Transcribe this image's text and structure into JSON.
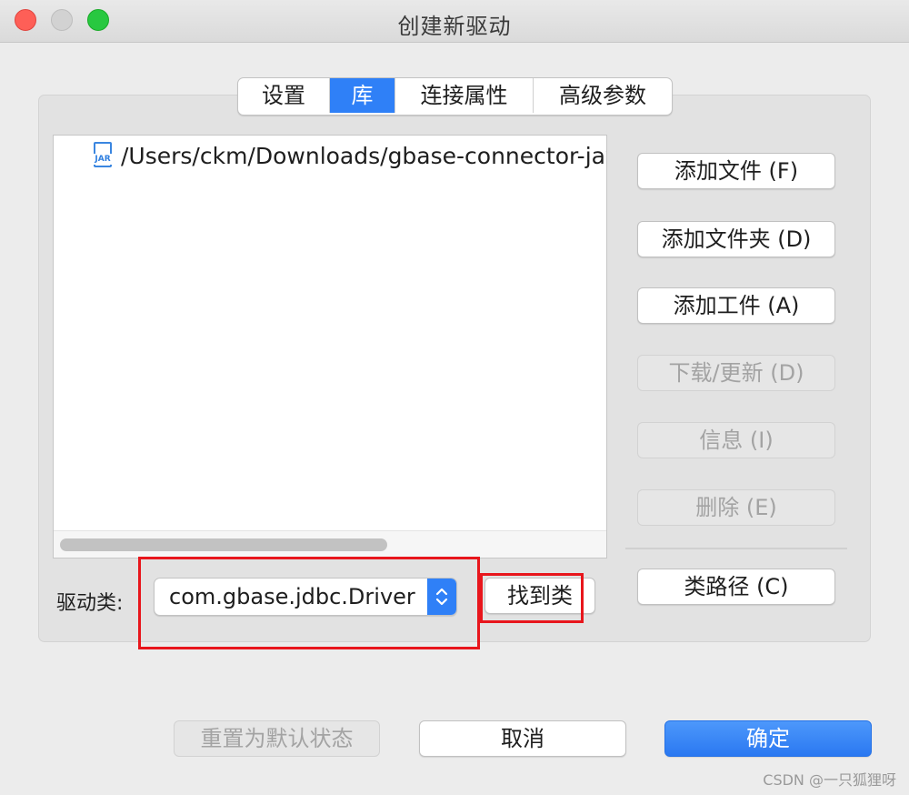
{
  "window": {
    "title": "创建新驱动"
  },
  "tabs": [
    {
      "label": "设置",
      "active": false
    },
    {
      "label": "库",
      "active": true
    },
    {
      "label": "连接属性",
      "active": false
    },
    {
      "label": "高级参数",
      "active": false
    }
  ],
  "library": {
    "items": [
      {
        "icon": "jar-file-icon",
        "icon_text": "JAR",
        "path": "/Users/ckm/Downloads/gbase-connector-jav"
      }
    ]
  },
  "side_buttons": {
    "add_file": "添加文件 (F)",
    "add_folder": "添加文件夹 (D)",
    "add_artifact": "添加工件 (A)",
    "download_update": "下载/更新 (D)",
    "info": "信息 (I)",
    "delete": "删除 (E)",
    "classpath": "类路径 (C)"
  },
  "driver_class": {
    "label": "驱动类:",
    "value": "com.gbase.jdbc.Driver",
    "find_button": "找到类"
  },
  "footer": {
    "reset": "重置为默认状态",
    "cancel": "取消",
    "ok": "确定"
  },
  "watermark": "CSDN @一只狐狸呀",
  "colors": {
    "accent": "#2f80f7",
    "highlight": "#e8161c",
    "close": "#fe5f57",
    "zoom": "#28c840"
  }
}
